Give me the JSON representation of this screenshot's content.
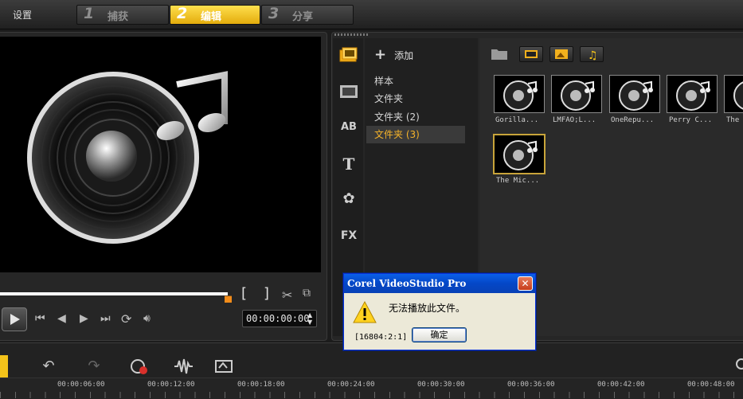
{
  "menu": {
    "settings_label": "设置"
  },
  "steps": [
    {
      "num": "1",
      "label": "捕获"
    },
    {
      "num": "2",
      "label": "编辑"
    },
    {
      "num": "3",
      "label": "分享"
    }
  ],
  "preview": {
    "timecode": "00:00:00:00",
    "trim_in": "[",
    "trim_out": "]"
  },
  "library": {
    "add_label": "添加",
    "folders": [
      "样本",
      "文件夹",
      "文件夹 (2)",
      "文件夹 (3)"
    ],
    "selected_folder": "文件夹 (3)",
    "thumbnails": [
      "Gorilla...",
      "LMFAO;L...",
      "OneRepu...",
      "Perry C...",
      "The",
      "The Mic..."
    ],
    "side_icons": [
      "media-icon",
      "transition-icon",
      "title-ab-icon",
      "text-icon",
      "graphic-icon",
      "fx-icon"
    ],
    "side_icon_text": {
      "ab": "AB",
      "title": "T",
      "fx": "FX"
    }
  },
  "timeline": {
    "ticks": [
      "00:00:06:00",
      "00:00:12:00",
      "00:00:18:00",
      "00:00:24:00",
      "00:00:30:00",
      "00:00:36:00",
      "00:00:42:00",
      "00:00:48:00"
    ]
  },
  "dialog": {
    "title": "Corel VideoStudio Pro",
    "close": "✕",
    "message": "无法播放此文件。",
    "code": "[16804:2:1]",
    "ok_label": "确定"
  },
  "colors": {
    "accent": "#f3c31a",
    "selected_folder_text": "#f5b32a",
    "scrub_handle": "#f28c1a"
  }
}
